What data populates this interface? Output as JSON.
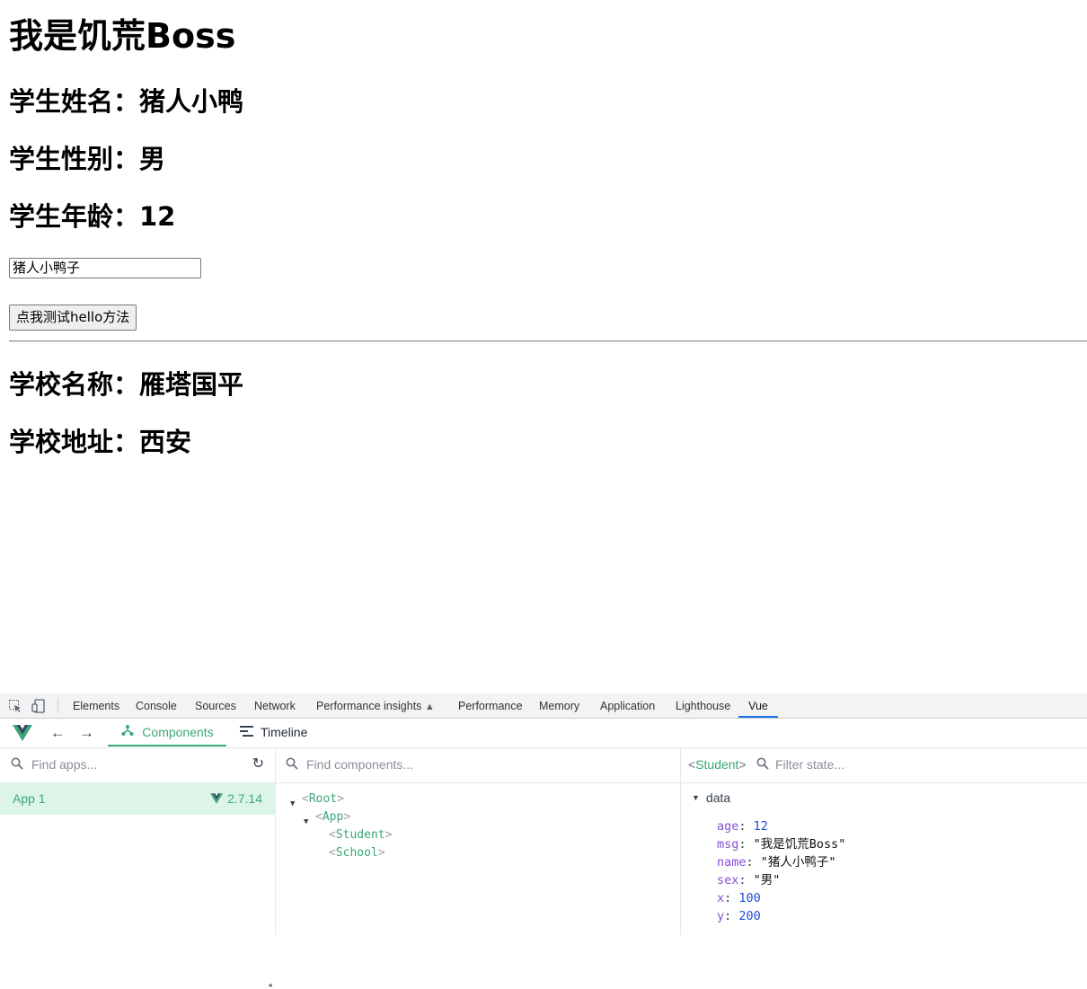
{
  "page": {
    "heading": "我是饥荒Boss",
    "student_name": "学生姓名：猪人小鸭",
    "student_sex": "学生性别：男",
    "student_age": "学生年龄：12",
    "name_input_value": "猪人小鸭子",
    "hello_button": "点我测试hello方法",
    "school_name": "学校名称：雁塔国平",
    "school_address": "学校地址：西安"
  },
  "devtools": {
    "tabs": [
      "Elements",
      "Console",
      "Sources",
      "Network",
      "Performance insights",
      "Performance",
      "Memory",
      "Application",
      "Lighthouse",
      "Vue"
    ],
    "active_tab": "Vue",
    "accent_color": "#1a73e8"
  },
  "vue": {
    "brand_color": "#3ba776",
    "tabs": {
      "components": "Components",
      "timeline": "Timeline"
    },
    "apps": {
      "search_placeholder": "Find apps...",
      "items": [
        {
          "name": "App 1",
          "version": "2.7.14"
        }
      ]
    },
    "components": {
      "search_placeholder": "Find components...",
      "tree": [
        {
          "tag": "Root",
          "expanded": true
        },
        {
          "tag": "App",
          "expanded": true
        },
        {
          "tag": "Student"
        },
        {
          "tag": "School"
        }
      ]
    },
    "inspector": {
      "selected": "Student",
      "filter_placeholder": "Filter state...",
      "section": "data",
      "state": [
        {
          "key": "age",
          "value": "12",
          "type": "number"
        },
        {
          "key": "msg",
          "value": "\"我是饥荒Boss\"",
          "type": "string"
        },
        {
          "key": "name",
          "value": "\"猪人小鸭子\"",
          "type": "string"
        },
        {
          "key": "sex",
          "value": "\"男\"",
          "type": "string"
        },
        {
          "key": "x",
          "value": "100",
          "type": "number"
        },
        {
          "key": "y",
          "value": "200",
          "type": "number"
        }
      ]
    }
  }
}
